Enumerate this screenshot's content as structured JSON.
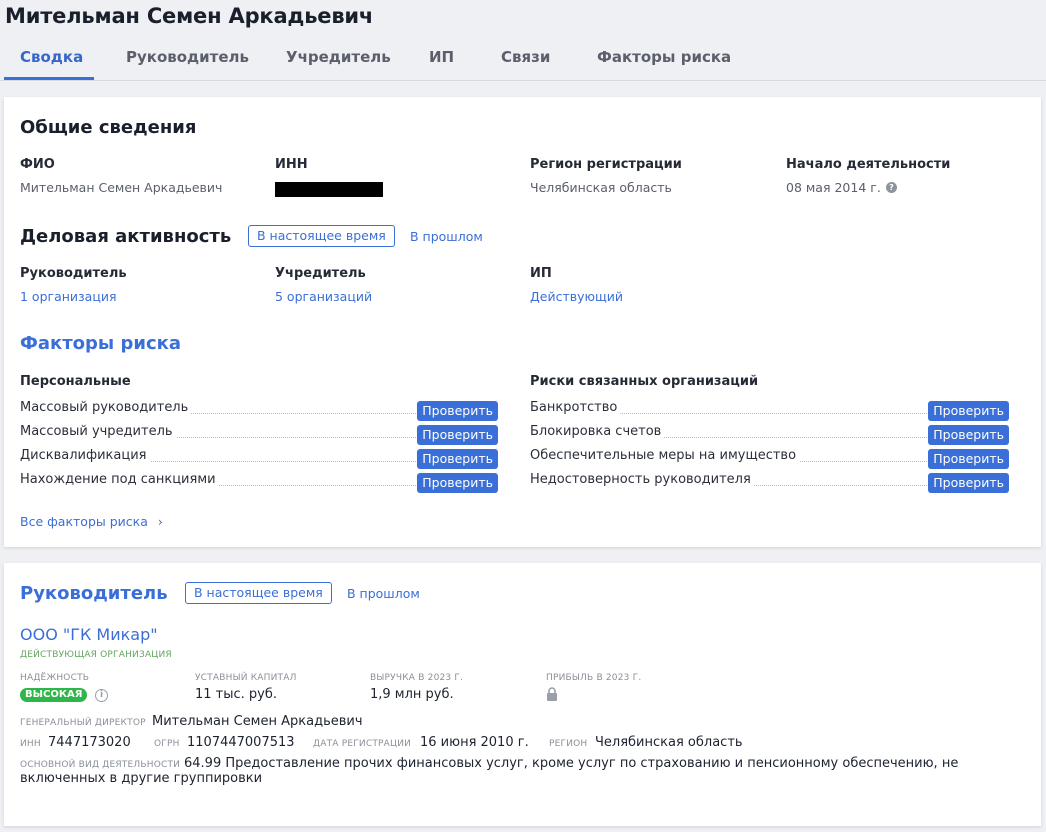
{
  "person": {
    "name": "Мительман Семен Аркадьевич"
  },
  "tabs": [
    "Сводка",
    "Руководитель",
    "Учредитель",
    "ИП",
    "Связи",
    "Факторы риска"
  ],
  "general": {
    "heading": "Общие сведения",
    "fio_label": "ФИО",
    "fio_value": "Мительман Семен Аркадьевич",
    "inn_label": "ИНН",
    "region_label": "Регион регистрации",
    "region_value": "Челябинская область",
    "start_label": "Начало деятельности",
    "start_value": "08 мая 2014 г."
  },
  "activity": {
    "heading": "Деловая активность",
    "now": "В настоящее время",
    "past": "В прошлом",
    "director_label": "Руководитель",
    "director_value": "1 организация",
    "founder_label": "Учредитель",
    "founder_value": "5 организаций",
    "ip_label": "ИП",
    "ip_value": "Действующий"
  },
  "risks": {
    "heading": "Факторы риска",
    "personal_heading": "Персональные",
    "related_heading": "Риски связанных организаций",
    "check_label": "Проверить",
    "personal": [
      "Массовый руководитель",
      "Массовый учредитель",
      "Дисквалификация",
      "Нахождение под санкциями"
    ],
    "related": [
      "Банкротство",
      "Блокировка счетов",
      "Обеспечительные меры на имущество",
      "Недостоверность руководителя"
    ],
    "all_link": "Все факторы риска"
  },
  "director": {
    "heading": "Руководитель",
    "now": "В настоящее время",
    "past": "В прошлом",
    "org_name": "ООО \"ГК Микар\"",
    "org_status": "ДЕЙСТВУЮЩАЯ ОРГАНИЗАЦИЯ",
    "reliability_label": "НАДЁЖНОСТЬ",
    "reliability_value": "ВЫСОКАЯ",
    "capital_label": "УСТАВНЫЙ КАПИТАЛ",
    "capital_value": "11 тыс. руб.",
    "revenue_label": "ВЫРУЧКА В 2023 Г.",
    "revenue_value": "1,9 млн руб.",
    "profit_label": "ПРИБЫЛЬ В 2023 Г.",
    "gd_label": "ГЕНЕРАЛЬНЫЙ ДИРЕКТОР",
    "gd_value": "Мительман Семен Аркадьевич",
    "inn_label": "ИНН",
    "inn_value": "7447173020",
    "ogrn_label": "ОГРН",
    "ogrn_value": "1107447007513",
    "reg_label": "ДАТА РЕГИСТРАЦИИ",
    "reg_value": "16 июня 2010 г.",
    "region_label": "РЕГИОН",
    "region_value": "Челябинская область",
    "okved_label": "ОСНОВНОЙ ВИД ДЕЯТЕЛЬНОСТИ",
    "okved_line1": "64.99 Предоставление прочих финансовых услуг, кроме услуг по страхованию и пенсионному обеспечению, не",
    "okved_line2": "включенных в другие группировки"
  }
}
